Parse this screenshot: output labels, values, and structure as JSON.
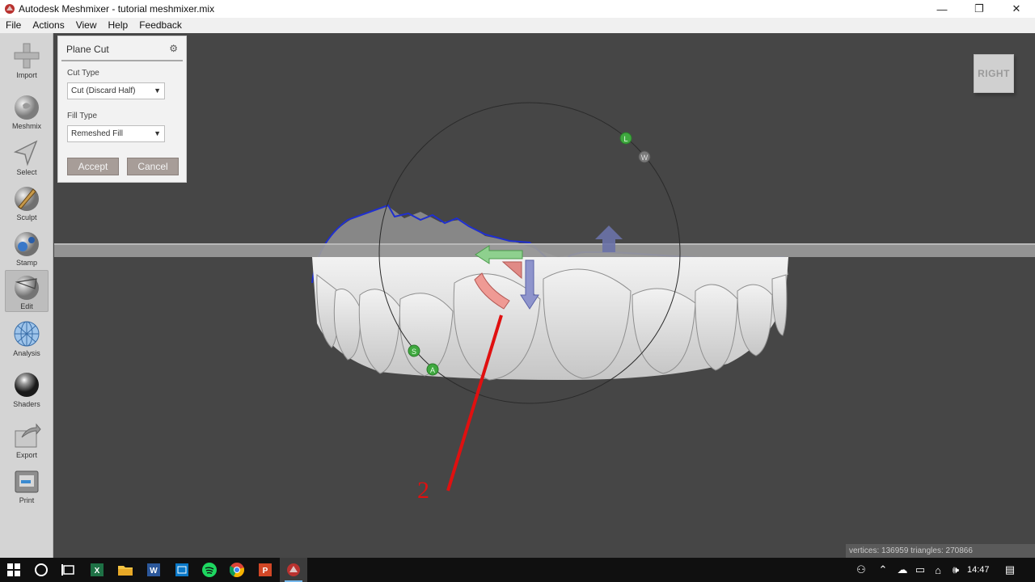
{
  "window": {
    "title": "Autodesk Meshmixer - tutorial meshmixer.mix",
    "minimize": "—",
    "restore": "❐",
    "close": "✕"
  },
  "menu": [
    "File",
    "Actions",
    "View",
    "Help",
    "Feedback"
  ],
  "toolbar": [
    {
      "label": "Import",
      "icon": "plus-icon"
    },
    {
      "label": "Meshmix",
      "icon": "bunny-sphere-icon"
    },
    {
      "label": "Select",
      "icon": "arrow-cursor-icon"
    },
    {
      "label": "Sculpt",
      "icon": "brush-sphere-icon"
    },
    {
      "label": "Stamp",
      "icon": "stamp-sphere-icon"
    },
    {
      "label": "Edit",
      "icon": "edit-sphere-icon"
    },
    {
      "label": "Analysis",
      "icon": "mesh-sphere-icon"
    },
    {
      "label": "Shaders",
      "icon": "shaded-sphere-icon"
    },
    {
      "label": "Export",
      "icon": "export-box-icon"
    },
    {
      "label": "Print",
      "icon": "printer-icon"
    }
  ],
  "active_tool": "Edit",
  "panel": {
    "title": "Plane Cut",
    "gear_icon": "gear-icon",
    "cut_type_label": "Cut Type",
    "cut_type_value": "Cut (Discard Half)",
    "fill_type_label": "Fill Type",
    "fill_type_value": "Remeshed Fill",
    "accept": "Accept",
    "cancel": "Cancel"
  },
  "viewcube": {
    "face": "RIGHT"
  },
  "gizmo": {
    "handles": [
      "L",
      "W",
      "S",
      "A"
    ]
  },
  "annotation": {
    "number": "2",
    "color": "#e01010"
  },
  "stats": "vertices: 136959 triangles: 270866",
  "taskbar": {
    "apps": [
      "start-icon",
      "cortana-icon",
      "task-view-icon",
      "excel-icon",
      "file-explorer-icon",
      "word-icon",
      "photos-icon",
      "spotify-icon",
      "chrome-icon",
      "powerpoint-icon",
      "meshmixer-icon"
    ],
    "clock": "14:47"
  }
}
